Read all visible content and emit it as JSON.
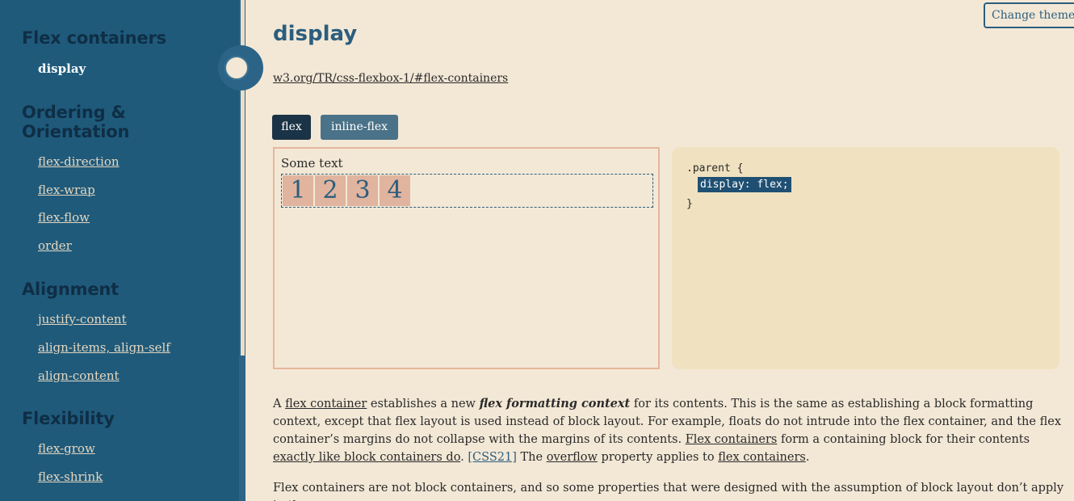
{
  "sidebar": {
    "sections": [
      {
        "title": "Flex containers"
      },
      {
        "title": "Ordering &"
      },
      {
        "title": "Orientation"
      },
      {
        "title": "Alignment"
      },
      {
        "title": "Flexibility"
      }
    ],
    "items": {
      "display": "display",
      "flex_direction": "flex-direction",
      "flex_wrap": "flex-wrap",
      "flex_flow": "flex-flow",
      "order": "order",
      "justify_content": "justify-content",
      "align_items": "align-items, align-self",
      "align_content": "align-content",
      "flex_grow": "flex-grow",
      "flex_shrink": "flex-shrink"
    }
  },
  "header": {
    "change_theme": "Change theme",
    "title": "display",
    "spec_link": "w3.org/TR/css-flexbox-1/#flex-containers"
  },
  "tabs": {
    "flex": "flex",
    "inline_flex": "inline-flex"
  },
  "demo": {
    "text": "Some text",
    "items": [
      "1",
      "2",
      "3",
      "4"
    ]
  },
  "code": {
    "line1": ".parent {",
    "line2": "display: flex;",
    "line3": "}"
  },
  "para1": {
    "t1": "A ",
    "l1": "flex container",
    "t2": " establishes a new ",
    "em": "flex formatting context",
    "t3": " for its contents. This is the same as establishing a block formatting context, except that flex layout is used instead of block layout. For example, floats do not intrude into the flex container, and the flex container’s margins do not collapse with the margins of its contents. ",
    "l2": "Flex containers",
    "t4": " form a containing block for their contents ",
    "l3": "exactly like block containers do",
    "t5": ". ",
    "l4": "[CSS21]",
    "t6": " The ",
    "l5": "overflow",
    "t7": " property applies to ",
    "l6": "flex containers",
    "t8": "."
  },
  "para2": {
    "text": "Flex containers are not block containers, and so some properties that were designed with the assumption of block layout don’t apply in the"
  },
  "colors": {
    "sidebar_bg": "#1f5a7b",
    "page_bg": "#f3e8d6",
    "accent": "#2c5e7e",
    "code_bg": "#f0e1c0",
    "item_bg": "#e0b49e"
  }
}
